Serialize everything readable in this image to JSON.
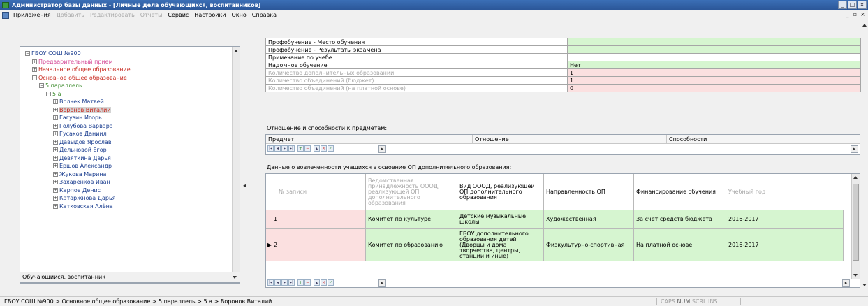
{
  "window": {
    "title": "Администратор базы данных - [Личные дела обучающихся, воспитанников]",
    "controls": [
      "_",
      "□",
      "×"
    ]
  },
  "menu": {
    "items": [
      {
        "label": "Приложения",
        "enabled": true
      },
      {
        "label": "Добавить",
        "enabled": false
      },
      {
        "label": "Редактировать",
        "enabled": false
      },
      {
        "label": "Отчеты",
        "enabled": false
      },
      {
        "label": "Сервис",
        "enabled": true
      },
      {
        "label": "Настройки",
        "enabled": true
      },
      {
        "label": "Окно",
        "enabled": true
      },
      {
        "label": "Справка",
        "enabled": true
      }
    ],
    "mdi_controls": [
      "_",
      "▫",
      "×"
    ]
  },
  "tree": {
    "nodes": [
      {
        "label": "ГБОУ СОШ №900",
        "color": "#1a3d8f",
        "expander": "⊟",
        "indent": 0
      },
      {
        "label": "Предварительный прием",
        "color": "#d6509a",
        "expander": "⊞",
        "indent": 1
      },
      {
        "label": "Начальное общее образование",
        "color": "#c8281e",
        "expander": "⊞",
        "indent": 1
      },
      {
        "label": "Основное общее образование",
        "color": "#c8281e",
        "expander": "⊟",
        "indent": 1
      },
      {
        "label": "5 параллель",
        "color": "#3a8a2a",
        "expander": "⊟",
        "indent": 2
      },
      {
        "label": "5 а",
        "color": "#3a8a2a",
        "expander": "⊟",
        "indent": 3
      },
      {
        "label": "Волчек Матвей",
        "color": "#1a3d8f",
        "expander": "⊞",
        "indent": 4
      },
      {
        "label": "Воронов Виталий",
        "color": "#c8281e",
        "expander": "⊞",
        "indent": 4,
        "selected": true
      },
      {
        "label": "Гагузин Игорь",
        "color": "#1a3d8f",
        "expander": "⊞",
        "indent": 4
      },
      {
        "label": "Голубова Варвара",
        "color": "#1a3d8f",
        "expander": "⊞",
        "indent": 4
      },
      {
        "label": "Гусаков Даниил",
        "color": "#1a3d8f",
        "expander": "⊞",
        "indent": 4
      },
      {
        "label": "Давыдов Ярослав",
        "color": "#1a3d8f",
        "expander": "⊞",
        "indent": 4
      },
      {
        "label": "Дельновой Егор",
        "color": "#1a3d8f",
        "expander": "⊞",
        "indent": 4
      },
      {
        "label": "Девяткина Дарья",
        "color": "#1a3d8f",
        "expander": "⊞",
        "indent": 4
      },
      {
        "label": "Ершов Александр",
        "color": "#1a3d8f",
        "expander": "⊞",
        "indent": 4
      },
      {
        "label": "Жукова Марина",
        "color": "#1a3d8f",
        "expander": "⊞",
        "indent": 4
      },
      {
        "label": "Захаренков Иван",
        "color": "#1a3d8f",
        "expander": "⊞",
        "indent": 4
      },
      {
        "label": "Карпов Денис",
        "color": "#1a3d8f",
        "expander": "⊞",
        "indent": 4
      },
      {
        "label": "Катаржнова Дарья",
        "color": "#1a3d8f",
        "expander": "⊞",
        "indent": 4
      },
      {
        "label": "Катковская Алёна",
        "color": "#1a3d8f",
        "expander": "⊞",
        "indent": 4
      }
    ],
    "footer_label": "Обучающийся, воспитанник"
  },
  "properties": [
    {
      "key": "Профобучение - Место обучения",
      "value": "",
      "value_bg": "green",
      "key_disabled": false
    },
    {
      "key": "Профобучение - Результаты экзамена",
      "value": "",
      "value_bg": "green",
      "key_disabled": false
    },
    {
      "key": "Примечание по учебе",
      "value": "",
      "value_bg": "white",
      "key_disabled": false
    },
    {
      "key": "Надомное обучение",
      "value": "Нет",
      "value_bg": "green",
      "key_disabled": false
    },
    {
      "key": "Количество дополнительных образований",
      "value": "1",
      "value_bg": "pink",
      "key_disabled": true
    },
    {
      "key": "Количество объединений (бюджет)",
      "value": "1",
      "value_bg": "pink",
      "key_disabled": true
    },
    {
      "key": "Количество объединений (на платной основе)",
      "value": "0",
      "value_bg": "pink",
      "key_disabled": true
    }
  ],
  "attitudes_section": {
    "title": "Отношение и способности к предметам:",
    "columns": [
      "Предмет",
      "Отношение",
      "Способности"
    ]
  },
  "navigator_buttons": [
    "|◂",
    "◂",
    "▸",
    "▸|",
    "+",
    "−",
    "▴",
    "×",
    "✓"
  ],
  "additional_ed_section": {
    "title": "Данные о вовлеченности учащихся в освоение ОП дополнительного образования:",
    "columns": [
      {
        "label": "№ записи",
        "disabled": true
      },
      {
        "label": "Ведомственная принадлежность ОООД, реализующей ОП дополнительного образования",
        "disabled": true
      },
      {
        "label": "Вид ОООД, реализующей ОП дополнительного образования",
        "disabled": false
      },
      {
        "label": "Направленность ОП",
        "disabled": false
      },
      {
        "label": "Финансирование обучения",
        "disabled": false
      },
      {
        "label": "Учебный год",
        "disabled": true
      }
    ],
    "rows": [
      {
        "num": "1",
        "dept": "Комитет по культуре",
        "kind": "Детские музыкальные школы",
        "direction": "Художественная",
        "funding": "За счет средств бюджета",
        "year": "2016-2017",
        "current": false
      },
      {
        "num": "2",
        "dept": "Комитет по образованию",
        "kind": "ГБОУ дополнительного образования детей (Дворцы и дома творчества, центры, станции и иные)",
        "direction": "Физкультурно-спортивная",
        "funding": "На платной основе",
        "year": "2016-2017",
        "current": true
      }
    ]
  },
  "status": {
    "path": "ГБОУ СОШ №900 > Основное общее образование > 5 параллель > 5 а > Воронов Виталий",
    "caps": "CAPS",
    "num": "NUM",
    "scrl": "SCRL",
    "ins": "INS"
  }
}
